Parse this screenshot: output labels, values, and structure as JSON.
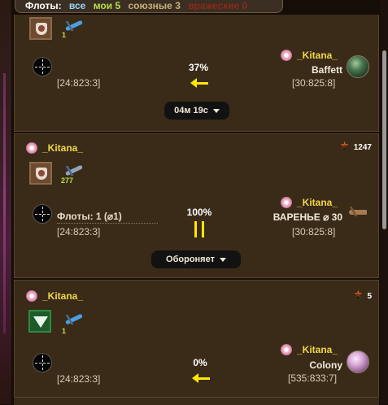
{
  "header": {
    "title": "Флоты:",
    "filters": {
      "all": "все",
      "mine": "мои 5",
      "allied": "союзные 3",
      "enemy": "вражеские 0"
    }
  },
  "cards": [
    {
      "badge_icon": "shield-icon",
      "ship_count": "1",
      "source_coords": "[24:823:3]",
      "percent": "37%",
      "status_icon": "arrow-left-icon",
      "target_player": "_Kitana_",
      "target_name": "Baffett",
      "target_coords": "[30:825:8]",
      "action_label": "04м 19с"
    },
    {
      "player": "_Kitana_",
      "rank_value": "1247",
      "badge_icon": "shield-icon",
      "ship_count": "277",
      "fleets_label": "Флоты: 1 (⌀1)",
      "source_coords": "[24:823:3]",
      "percent": "100%",
      "status_icon": "pause-icon",
      "target_player": "_Kitana_",
      "target_name": "ВАРЕНЬЕ ⌀ 30",
      "target_coords": "[30:825:8]",
      "action_label": "Обороняет"
    },
    {
      "player": "_Kitana_",
      "rank_value": "5",
      "badge_icon": "green-banner-icon",
      "ship_count": "1",
      "source_coords": "[24:823:3]",
      "percent": "0%",
      "status_icon": "arrow-left-icon",
      "target_player": "_Kitana_",
      "target_name": "Colony",
      "target_coords": "[535:833:7]"
    }
  ]
}
